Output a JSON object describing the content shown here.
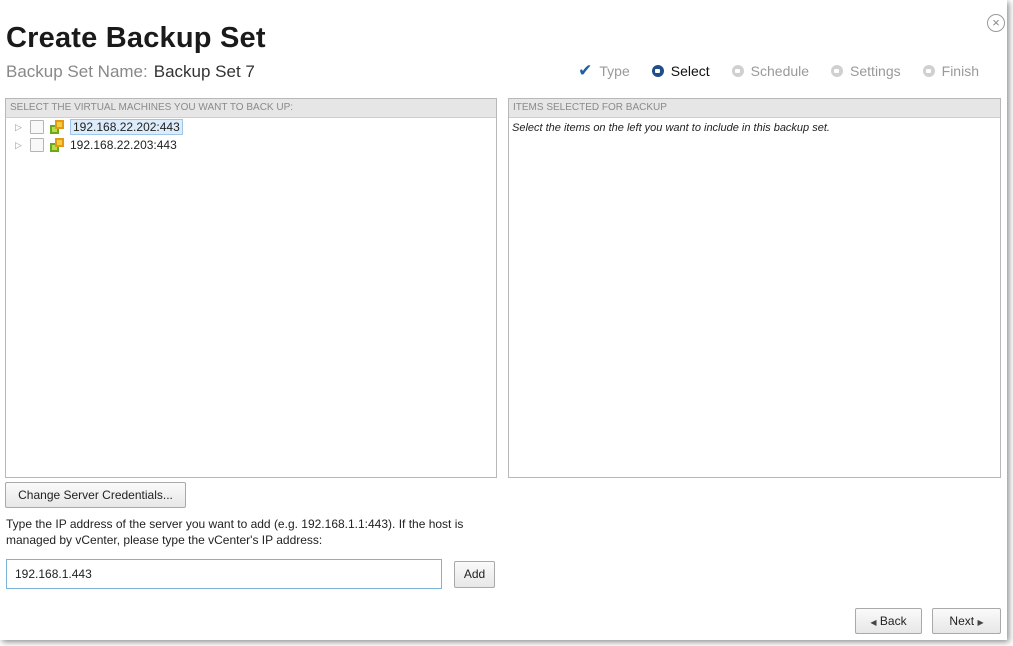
{
  "dialog": {
    "title": "Create Backup Set",
    "set_name_label": "Backup Set Name:",
    "set_name_value": "Backup Set 7",
    "close_glyph": "×"
  },
  "steps": [
    {
      "label": "Type",
      "state": "done"
    },
    {
      "label": "Select",
      "state": "current"
    },
    {
      "label": "Schedule",
      "state": "pending"
    },
    {
      "label": "Settings",
      "state": "pending"
    },
    {
      "label": "Finish",
      "state": "pending"
    }
  ],
  "left_panel": {
    "header": "SELECT THE VIRTUAL MACHINES YOU WANT TO BACK UP:",
    "hosts": [
      {
        "label": "192.168.22.202:443",
        "selected": true,
        "icon": "vmware-host-icon"
      },
      {
        "label": "192.168.22.203:443",
        "selected": false,
        "icon": "vmware-host-icon"
      }
    ]
  },
  "right_panel": {
    "header": "ITEMS SELECTED FOR BACKUP",
    "note": "Select the items on the left you want to include in this backup set."
  },
  "credentials_button": "Change Server Credentials...",
  "help_text": "Type the IP address of the server you want to add (e.g. 192.168.1.1:443). If the host is managed by vCenter, please type the vCenter's IP address:",
  "ip_input": {
    "value": "192.168.1.443"
  },
  "add_button": "Add",
  "nav": {
    "back": "Back",
    "next": "Next"
  },
  "colors": {
    "accent": "#1f4f8a",
    "check": "#1f5fa0",
    "selection": "#dcecfa"
  }
}
